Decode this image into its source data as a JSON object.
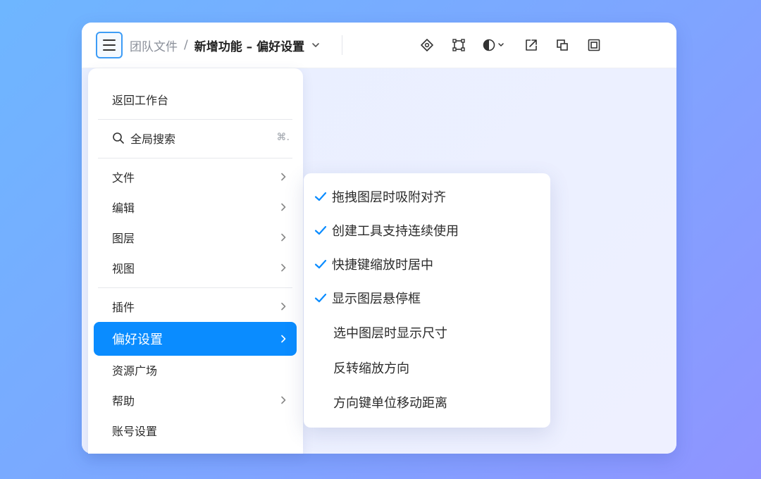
{
  "topbar": {
    "menu_icon": "hamburger-icon",
    "breadcrumb": {
      "team": "团队文件",
      "separator": "/",
      "file": "新增功能 – 偏好设置",
      "chevron_icon": "chevron-down-icon"
    },
    "tools": [
      {
        "name": "component-icon"
      },
      {
        "name": "frame-icon"
      },
      {
        "name": "theme-toggle-icon"
      },
      {
        "name": "export-icon"
      },
      {
        "name": "layers-icon"
      },
      {
        "name": "present-icon"
      }
    ]
  },
  "main_menu": {
    "items": [
      {
        "label": "返回工作台"
      },
      {
        "label": "全局搜索",
        "shortcut": "⌘.",
        "icon": "search-icon"
      },
      {
        "label": "文件",
        "has_submenu": true
      },
      {
        "label": "编辑",
        "has_submenu": true
      },
      {
        "label": "图层",
        "has_submenu": true
      },
      {
        "label": "视图",
        "has_submenu": true
      },
      {
        "label": "插件",
        "has_submenu": true
      },
      {
        "label": "偏好设置",
        "has_submenu": true,
        "active": true
      },
      {
        "label": "资源广场"
      },
      {
        "label": "帮助",
        "has_submenu": true
      },
      {
        "label": "账号设置"
      }
    ]
  },
  "preferences_submenu": {
    "items": [
      {
        "label": "拖拽图层时吸附对齐",
        "checked": true
      },
      {
        "label": "创建工具支持连续使用",
        "checked": true
      },
      {
        "label": "快捷键缩放时居中",
        "checked": true
      },
      {
        "label": "显示图层悬停框",
        "checked": true
      },
      {
        "label": "选中图层时显示尺寸",
        "checked": false
      },
      {
        "label": "反转缩放方向",
        "checked": false
      },
      {
        "label": "方向键单位移动距离",
        "checked": false
      }
    ]
  },
  "colors": {
    "accent": "#0a8cff",
    "check": "#0a8cff",
    "background_start": "#6eb6ff",
    "background_end": "#8f94ff"
  }
}
